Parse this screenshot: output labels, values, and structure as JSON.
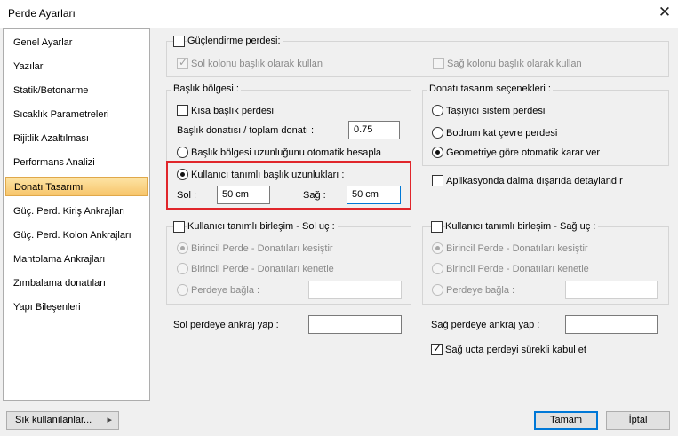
{
  "window": {
    "title": "Perde Ayarları",
    "close_glyph": "✕"
  },
  "sidebar": {
    "items": [
      {
        "label": "Genel Ayarlar"
      },
      {
        "label": "Yazılar"
      },
      {
        "label": "Statik/Betonarme"
      },
      {
        "label": "Sıcaklık Parametreleri"
      },
      {
        "label": "Rijitlik Azaltılması"
      },
      {
        "label": "Performans Analizi"
      },
      {
        "label": "Donatı Tasarımı",
        "selected": true
      },
      {
        "label": "Güç. Perd. Kiriş Ankrajları"
      },
      {
        "label": "Güç. Perd. Kolon Ankrajları"
      },
      {
        "label": "Mantolama Ankrajları"
      },
      {
        "label": "Zımbalama donatıları"
      },
      {
        "label": "Yapı Bileşenleri"
      }
    ]
  },
  "strengthening": {
    "label": "Güçlendirme perdesi:",
    "checked": false,
    "left_col_label": "Sol kolonu başlık olarak kullan",
    "left_col_checked": true,
    "right_col_label": "Sağ kolonu başlık olarak kullan",
    "right_col_checked": false
  },
  "header_region": {
    "title": "Başlık bölgesi :",
    "short_header_label": "Kısa başlık perdesi",
    "ratio_label": "Başlık donatısı / toplam donatı :",
    "ratio_value": "0.75",
    "auto_length_label": "Başlık bölgesi uzunluğunu otomatik hesapla",
    "user_length_label": "Kullanıcı tanımlı başlık uzunlukları :",
    "left_label": "Sol :",
    "left_value": "50 cm",
    "right_label": "Sağ :",
    "right_value": "50 cm"
  },
  "design_options": {
    "title": "Donatı tasarım seçenekleri :",
    "options": [
      {
        "label": "Taşıyıcı sistem perdesi",
        "selected": false
      },
      {
        "label": "Bodrum kat çevre perdesi",
        "selected": false
      },
      {
        "label": "Geometriye göre otomatik karar ver",
        "selected": true
      }
    ],
    "detail_label": "Aplikasyonda daima dışarıda detaylandır",
    "detail_checked": false
  },
  "left_joint": {
    "label": "Kullanıcı tanımlı birleşim - Sol uç :",
    "options": [
      "Birincil Perde - Donatıları kesiştir",
      "Birincil Perde - Donatıları kenetle",
      "Perdeye bağla :"
    ],
    "value": ""
  },
  "right_joint": {
    "label": "Kullanıcı tanımlı birleşim - Sağ uç :",
    "options": [
      "Birincil Perde - Donatıları kesiştir",
      "Birincil Perde - Donatıları kenetle",
      "Perdeye bağla :"
    ],
    "value": ""
  },
  "anchor": {
    "left_label": "Sol perdeye ankraj yap :",
    "left_value": "",
    "right_label": "Sağ perdeye ankraj yap :",
    "right_value": "",
    "continuous_label": "Sağ ucta perdeyi sürekli kabul et",
    "continuous_checked": true
  },
  "footer": {
    "frequent_label": "Sık kullanılanlar...",
    "frequent_arrow": "▸",
    "ok_label": "Tamam",
    "cancel_label": "İptal"
  },
  "colors": {
    "highlight": "#e0262b",
    "accent": "#0078d7",
    "selection": "#f7c56b"
  }
}
